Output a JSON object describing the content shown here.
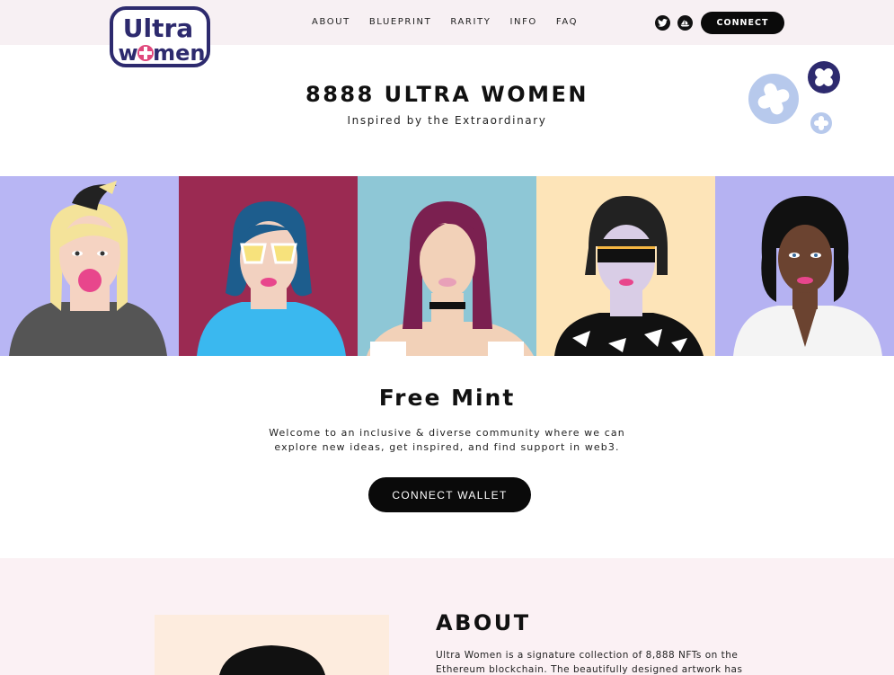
{
  "brand": {
    "logo_text_top": "Ultra",
    "logo_text_bottom": "women",
    "primary_color": "#2d2a6e",
    "accent_color": "#e0487c"
  },
  "header": {
    "nav": [
      "ABOUT",
      "BLUEPRINT",
      "RARITY",
      "INFO",
      "FAQ"
    ],
    "social_icons": [
      "twitter-icon",
      "opensea-icon"
    ],
    "connect_label": "CONNECT"
  },
  "hero": {
    "title": "8888 ULTRA WOMEN",
    "subtitle": "Inspired by the Extraordinary"
  },
  "portraits": [
    {
      "name": "portrait-1",
      "bg": "#b8b6f4"
    },
    {
      "name": "portrait-2",
      "bg": "#9b2a52"
    },
    {
      "name": "portrait-3",
      "bg": "#8ec7d6"
    },
    {
      "name": "portrait-4",
      "bg": "#fde4b8"
    },
    {
      "name": "portrait-5",
      "bg": "#b5b2f2"
    }
  ],
  "mint": {
    "title": "Free Mint",
    "text_line1": "Welcome to an inclusive & diverse community where we can",
    "text_line2": "explore new ideas, get inspired, and find support in web3.",
    "cta_label": "CONNECT WALLET"
  },
  "about": {
    "title": "ABOUT",
    "text_line1": "Ultra Women is a signature collection of 8,888 NFTs on the",
    "text_line2": "Ethereum blockchain. The beautifully designed artwork has"
  }
}
